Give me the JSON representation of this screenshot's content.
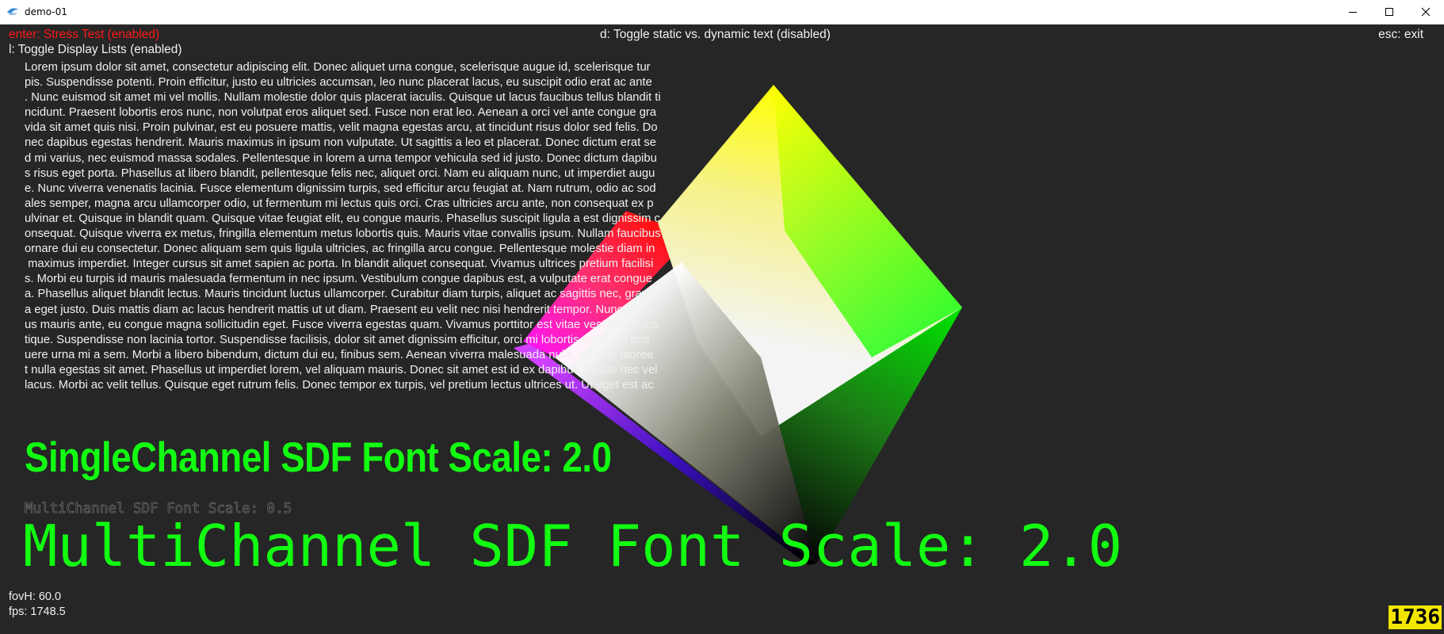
{
  "window": {
    "title": "demo-01",
    "minimize_icon": "minimize-icon",
    "maximize_icon": "maximize-icon",
    "close_icon": "close-icon"
  },
  "hud": {
    "stress_test": "enter: Stress Test (enabled)",
    "display_lists": "l: Toggle Display Lists (enabled)",
    "static_dynamic": "d: Toggle static vs. dynamic text (disabled)",
    "exit": "esc: exit",
    "fov": "fovH: 60.0",
    "fps": "fps: 1748.5",
    "frame_counter": "1736"
  },
  "lorem": [
    "Lorem ipsum dolor sit amet, consectetur adipiscing elit. Donec aliquet urna congue, scelerisque augue id, scelerisque tur",
    "pis. Suspendisse potenti. Proin efficitur, justo eu ultricies accumsan, leo nunc placerat lacus, eu suscipit odio erat ac ante",
    ". Nunc euismod sit amet mi vel mollis. Nullam molestie dolor quis placerat iaculis. Quisque ut lacus faucibus tellus blandit ti",
    "ncidunt. Praesent lobortis eros nunc, non volutpat eros aliquet sed. Fusce non erat leo. Aenean a orci vel ante congue gra",
    "vida sit amet quis nisi. Proin pulvinar, est eu posuere mattis, velit magna egestas arcu, at tincidunt risus dolor sed felis. Do",
    "nec dapibus egestas hendrerit. Mauris maximus in ipsum non vulputate. Ut sagittis a leo et placerat. Donec dictum erat se",
    "d mi varius, nec euismod massa sodales. Pellentesque in lorem a urna tempor vehicula sed id justo. Donec dictum dapibu",
    "s risus eget porta. Phasellus at libero blandit, pellentesque felis nec, aliquet orci. Nam eu aliquam nunc, ut imperdiet augu",
    "e. Nunc viverra venenatis lacinia. Fusce elementum dignissim turpis, sed efficitur arcu feugiat at. Nam rutrum, odio ac sod",
    "ales semper, magna arcu ullamcorper odio, ut fermentum mi lectus quis orci. Cras ultricies arcu ante, non consequat ex p",
    "ulvinar et. Quisque in blandit quam. Quisque vitae feugiat elit, eu congue mauris. Phasellus suscipit ligula a est dignissim c",
    "onsequat. Quisque viverra ex metus, fringilla elementum metus lobortis quis. Mauris vitae convallis ipsum. Nullam faucibus",
    "ornare dui eu consectetur. Donec aliquam sem quis ligula ultricies, ac fringilla arcu congue. Pellentesque molestie diam in",
    " maximus imperdiet. Integer cursus sit amet sapien ac porta. In blandit aliquet consequat. Vivamus ultrices pretium facilisi",
    "s. Morbi eu turpis id mauris malesuada fermentum in nec ipsum. Vestibulum congue dapibus est, a vulputate erat congue",
    "a. Phasellus aliquet blandit lectus. Mauris tincidunt luctus ullamcorper. Curabitur diam turpis, aliquet ac sagittis nec, gravid",
    "a eget justo. Duis mattis diam ac lacus hendrerit mattis ut ut diam. Praesent eu velit nec nisi hendrerit tempor. Nunc dapib",
    "us mauris ante, eu congue magna sollicitudin eget. Fusce viverra egestas quam. Vivamus porttitor est vitae vestibulum tris",
    "tique. Suspendisse non lacinia tortor. Suspendisse facilisis, dolor sit amet dignissim efficitur, orci mi lobortis urna, vel pos",
    "uere urna mi a sem. Morbi a libero bibendum, dictum dui eu, finibus sem. Aenean viverra malesuada nulla, efficitur laoree",
    "t nulla egestas sit amet. Phasellus ut imperdiet lorem, vel aliquam mauris. Donec sit amet est id ex dapibus cursus nec vel",
    "lacus. Morbi ac velit tellus. Quisque eget rutrum felis. Donec tempor ex turpis, vel pretium lectus ultrices ut. Ut eget est ac"
  ],
  "sdf_single": "SingleChannel SDF Font Scale: 2.0",
  "msdf_small": "MultiChannel SDF Font Scale: 0.5",
  "msdf_big": "MultiChannel SDF Font Scale: 2.0",
  "colors": {
    "background": "#262626",
    "hud_red": "#ff1a1a",
    "hud_text": "#f0f0f0",
    "sdf_green": "#12ff12",
    "counter_yellow": "#f2e600"
  }
}
